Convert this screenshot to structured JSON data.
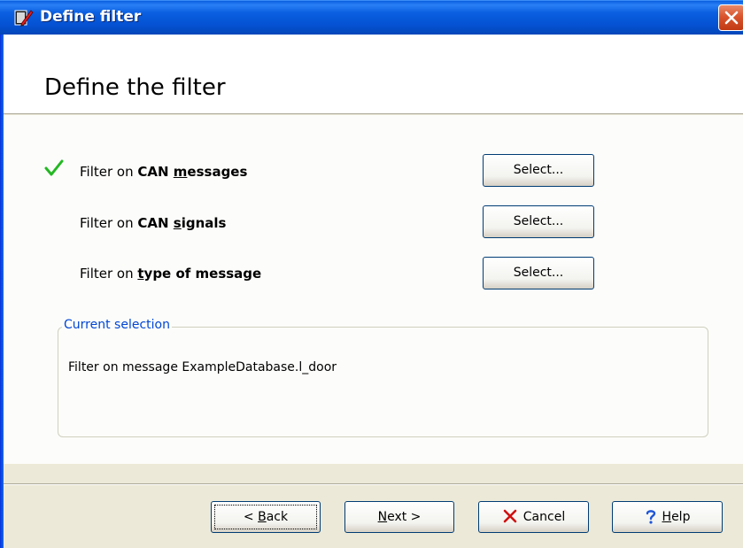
{
  "window": {
    "title": "Define filter",
    "icon": "filter-app-icon",
    "close_icon": "close-icon"
  },
  "header": {
    "title": "Define the filter"
  },
  "filters": [
    {
      "prefix": "Filter on ",
      "bold_pre": "CAN ",
      "bold_ul": "m",
      "bold_post": "essages",
      "checked": true,
      "button_label": "Select..."
    },
    {
      "prefix": "Filter on ",
      "bold_pre": "CAN ",
      "bold_ul": "s",
      "bold_post": "ignals",
      "checked": false,
      "button_label": "Select..."
    },
    {
      "prefix": "Filter on ",
      "bold_pre": "",
      "bold_ul": "t",
      "bold_post": "ype of message",
      "checked": false,
      "button_label": "Select..."
    }
  ],
  "current_selection": {
    "legend": "Current selection",
    "text": "Filter on message ExampleDatabase.l_door"
  },
  "footer": {
    "back": {
      "pre": "< ",
      "ul": "B",
      "post": "ack"
    },
    "next": {
      "pre": "",
      "ul": "N",
      "post": "ext >"
    },
    "cancel": {
      "label": "Cancel",
      "icon": "x-icon"
    },
    "help": {
      "pre": "",
      "ul": "H",
      "post": "elp",
      "icon": "question-icon"
    }
  },
  "colors": {
    "titlebar": "#0a5fe0",
    "check": "#22b822",
    "legend": "#0046d5",
    "cancel_x": "#d01010",
    "help_q": "#1f56d8"
  }
}
